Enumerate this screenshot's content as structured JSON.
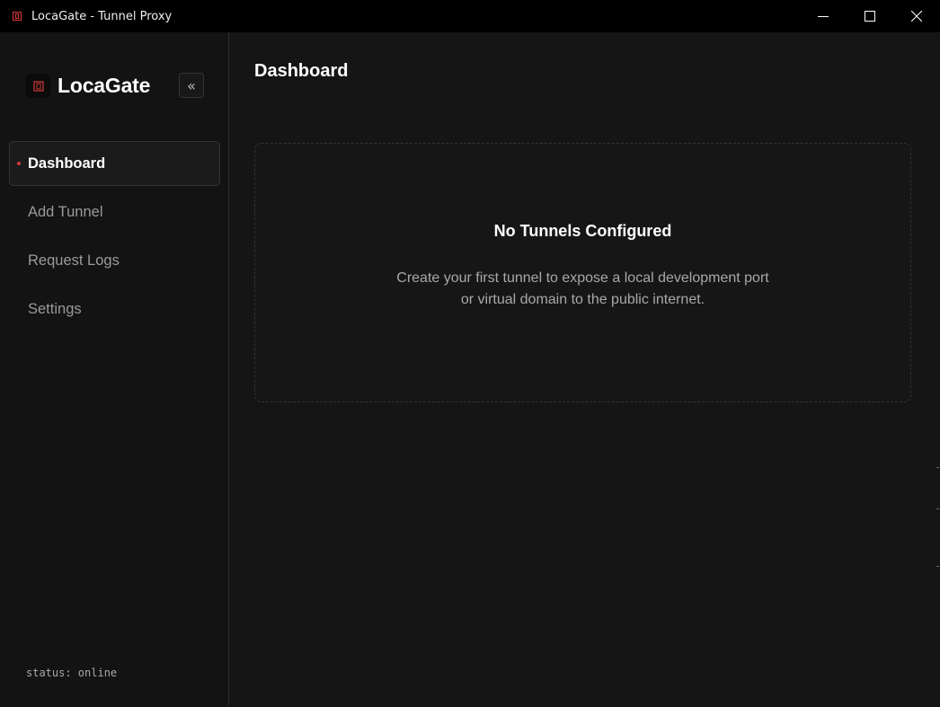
{
  "window": {
    "title": "LocaGate - Tunnel Proxy",
    "controls": [
      "minimize",
      "maximize",
      "close"
    ]
  },
  "sidebar": {
    "brand": "LocaGate",
    "collapse_label": "«",
    "items": [
      {
        "label": "Dashboard",
        "active": true
      },
      {
        "label": "Add Tunnel",
        "active": false
      },
      {
        "label": "Request Logs",
        "active": false
      },
      {
        "label": "Settings",
        "active": false
      }
    ],
    "status": "status: online"
  },
  "main": {
    "title": "Dashboard",
    "empty_state": {
      "title": "No Tunnels Configured",
      "line1": "Create your first tunnel to expose a local development port",
      "line2": "or virtual domain to the public internet."
    }
  },
  "colors": {
    "accent": "#d23a3a",
    "background": "#151515",
    "sidebar": "#131313",
    "titlebar": "#000000"
  }
}
